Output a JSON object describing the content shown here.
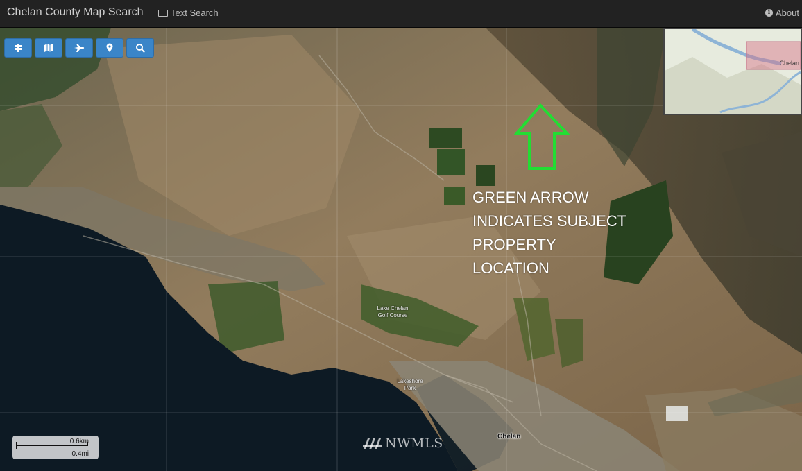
{
  "navbar": {
    "title": "Chelan County Map Search",
    "text_search_label": "Text Search",
    "about_label": "About"
  },
  "toolbar": {
    "buttons": [
      {
        "icon": "road-sign-icon"
      },
      {
        "icon": "map-icon"
      },
      {
        "icon": "plane-icon"
      },
      {
        "icon": "map-marker-icon"
      },
      {
        "icon": "search-icon"
      }
    ]
  },
  "annotation": {
    "lines": [
      "GREEN ARROW",
      "INDICATES SUBJECT",
      "PROPERTY",
      "LOCATION"
    ],
    "arrow_color": "#22dd33"
  },
  "map_labels": {
    "golf_course": "Lake Chelan Golf Course",
    "park": "Lakeshore Park",
    "city": "Chelan"
  },
  "overview_map": {
    "label": "Chelan"
  },
  "scale_bar": {
    "km": "0.6km",
    "mi": "0.4mi"
  },
  "watermark": "NWMLS",
  "colors": {
    "navbar_bg": "#222222",
    "toolbar_button": "#3a85c8",
    "lake": "#0d1a24",
    "terrain": "#8a7a5e"
  }
}
